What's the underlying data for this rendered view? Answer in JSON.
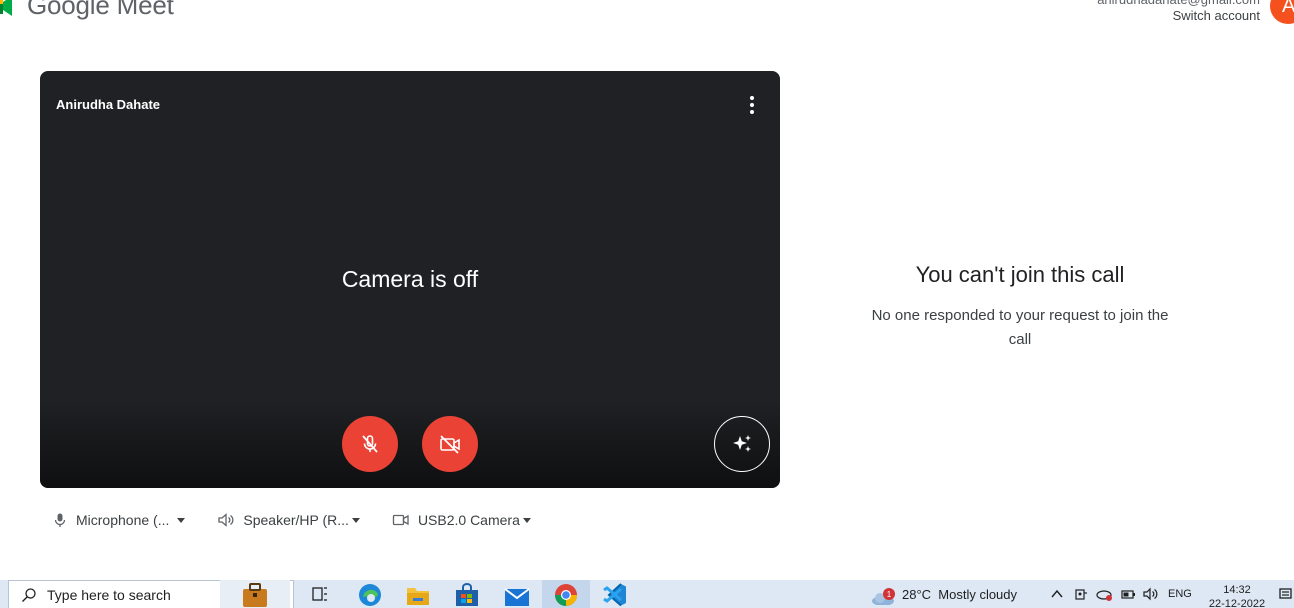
{
  "header": {
    "logo_google": "Google",
    "logo_meet": "Meet",
    "email": "anirudhadahate@gmail.com",
    "switch_account": "Switch account",
    "avatar_initial": "A"
  },
  "tile": {
    "name": "Anirudha Dahate",
    "camera_off": "Camera is off"
  },
  "devices": {
    "microphone": "Microphone (...",
    "speaker": "Speaker/HP (R...",
    "camera": "USB2.0 Camera"
  },
  "message": {
    "title": "You can't join this call",
    "subtitle": "No one responded to your request to join the call"
  },
  "taskbar": {
    "search_placeholder": "Type here to search",
    "weather_badge": "1",
    "weather_text": "28°C  Mostly cloudy",
    "lang": "ENG",
    "time": "14:32",
    "date": "22-12-2022"
  },
  "colors": {
    "tile_bg": "#202124",
    "control_red": "#ea4335",
    "taskbar_bg": "#dde8f4",
    "avatar": "#f4511e"
  }
}
